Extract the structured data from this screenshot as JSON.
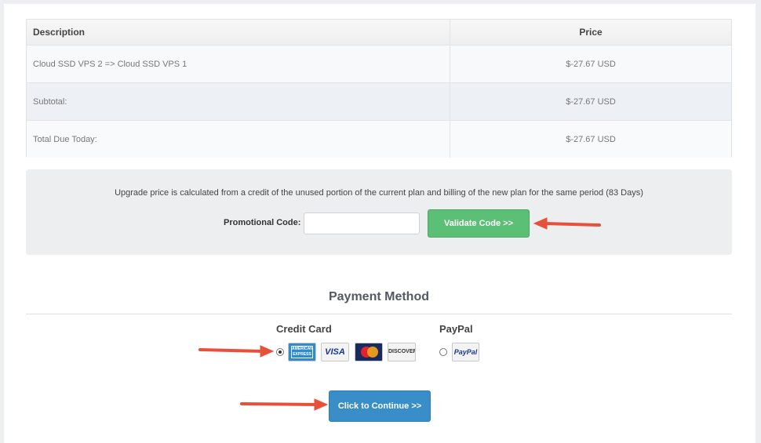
{
  "table": {
    "headers": {
      "description": "Description",
      "price": "Price"
    },
    "rows": [
      {
        "description": "Cloud SSD VPS 2 => Cloud SSD VPS 1",
        "price": "$-27.67 USD"
      },
      {
        "description": "Subtotal:",
        "price": "$-27.67 USD"
      },
      {
        "description": "Total Due Today:",
        "price": "$-27.67 USD"
      }
    ]
  },
  "promo": {
    "note": "Upgrade price is calculated from a credit of the unused portion of the current plan and billing of the new plan for the same period (83 Days)",
    "label": "Promotional Code:",
    "input_value": "",
    "validate_label": "Validate Code >>"
  },
  "payment": {
    "title": "Payment Method",
    "credit_card": {
      "label": "Credit Card",
      "selected": true
    },
    "paypal": {
      "label": "PayPal",
      "selected": false
    },
    "card_logos": [
      "AMERICAN EXPRESS",
      "VISA",
      "mastercard",
      "DISCOVER"
    ],
    "paypal_logo": "PayPal",
    "continue_label": "Click to Continue >>"
  },
  "colors": {
    "validate_button": "#5cbf76",
    "continue_button": "#3a8ec8",
    "annotation_arrow": "#e8503a"
  }
}
